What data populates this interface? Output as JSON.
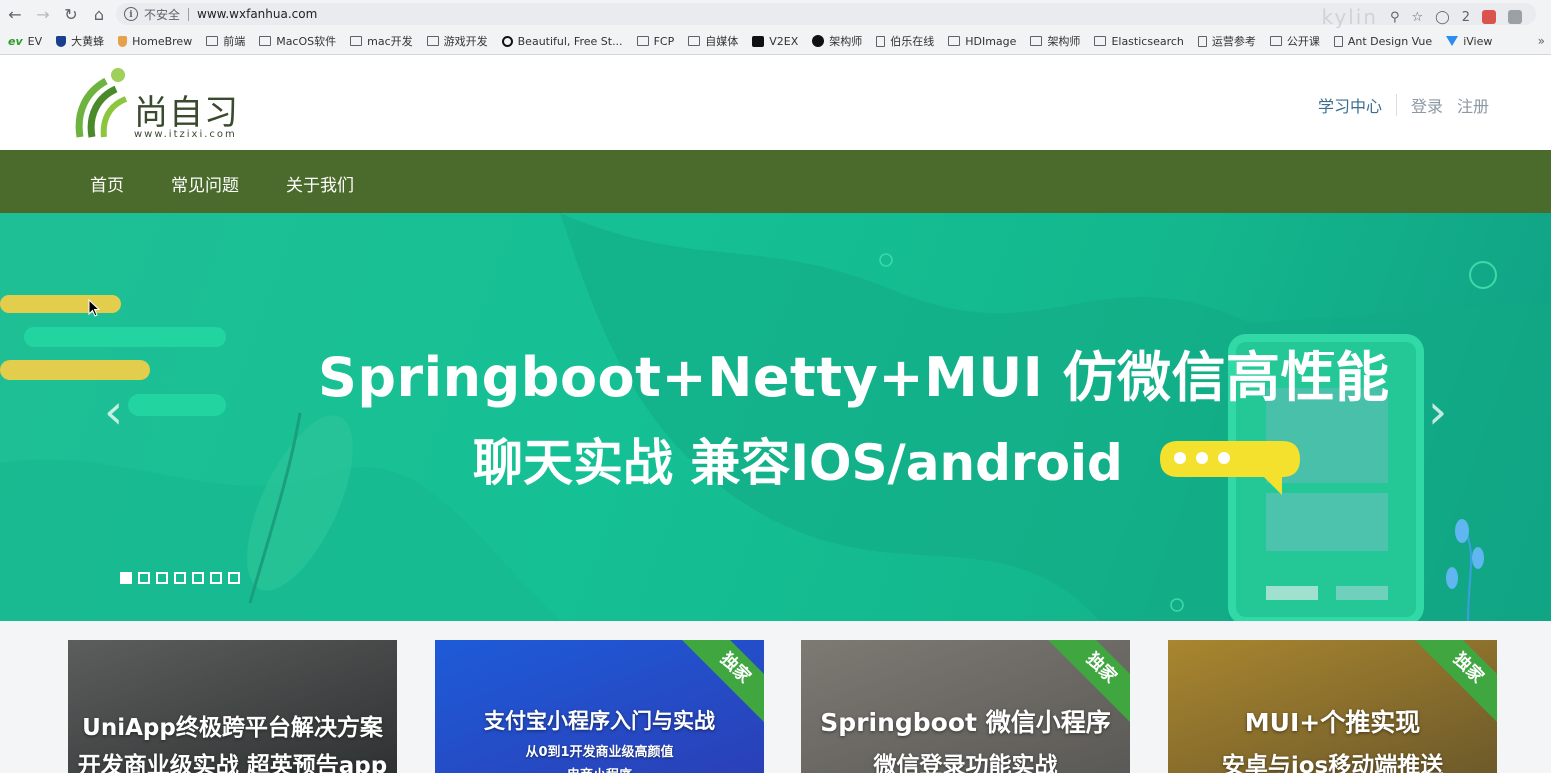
{
  "browser": {
    "insecure_label": "不安全",
    "url": "www.wxfanhua.com",
    "overlay_text": "kylin",
    "badge_count": "2",
    "bookmarks": [
      {
        "label": "EV",
        "icon": "ev-icon"
      },
      {
        "label": "大黄蜂",
        "icon": "shield-icon"
      },
      {
        "label": "HomeBrew",
        "icon": "cup-icon"
      },
      {
        "label": "前端",
        "icon": "folder-icon"
      },
      {
        "label": "MacOS软件",
        "icon": "folder-icon"
      },
      {
        "label": "mac开发",
        "icon": "folder-icon"
      },
      {
        "label": "游戏开发",
        "icon": "folder-icon"
      },
      {
        "label": "Beautiful, Free St...",
        "icon": "circle-icon"
      },
      {
        "label": "FCP",
        "icon": "folder-icon"
      },
      {
        "label": "自媒体",
        "icon": "folder-icon"
      },
      {
        "label": "V2EX",
        "icon": "v2ex-icon"
      },
      {
        "label": "架构师",
        "icon": "github-icon"
      },
      {
        "label": "伯乐在线",
        "icon": "page-icon"
      },
      {
        "label": "HDImage",
        "icon": "folder-icon"
      },
      {
        "label": "架构师",
        "icon": "folder-icon"
      },
      {
        "label": "Elasticsearch",
        "icon": "folder-icon"
      },
      {
        "label": "运营参考",
        "icon": "page-icon"
      },
      {
        "label": "公开课",
        "icon": "folder-icon"
      },
      {
        "label": "Ant Design Vue",
        "icon": "page-icon"
      },
      {
        "label": "iView",
        "icon": "iview-icon"
      }
    ]
  },
  "header": {
    "logo_text": "尚自习",
    "logo_url": "www.itzixi.com",
    "study_center": "学习中心",
    "login": "登录",
    "register": "注册"
  },
  "nav": {
    "items": [
      "首页",
      "常见问题",
      "关于我们"
    ]
  },
  "banner": {
    "line1": "Springboot+Netty+MUI 仿微信高性能",
    "line2": "聊天实战 兼容IOS/android",
    "slide_count": 7,
    "active_slide": 1
  },
  "courses": [
    {
      "title1": "UniApp终极跨平台解决方案",
      "title2": "开发商业级实战 超英预告app",
      "badge": "",
      "colors": [
        "#5b5e5d",
        "#2f3232"
      ]
    },
    {
      "title1": "支付宝小程序入门与实战",
      "title2": "从0到1开发商业级高颜值",
      "title3": "电商小程序",
      "badge": "独家",
      "colors": [
        "#1e5bd8",
        "#2a40b8"
      ]
    },
    {
      "title1": "Springboot 微信小程序",
      "title2": "微信登录功能实战",
      "badge": "独家",
      "colors": [
        "#7d7a74",
        "#5b5955"
      ]
    },
    {
      "title1": "MUI+个推实现",
      "title2": "安卓与ios移动端推送",
      "badge": "独家",
      "colors": [
        "#a9862f",
        "#6d5a2a"
      ]
    }
  ],
  "colors": {
    "nav_bg": "#4a6b2b",
    "banner_bg": "#15c094",
    "ribbon": "#3fa640",
    "link_blue": "#3b6d8f"
  }
}
